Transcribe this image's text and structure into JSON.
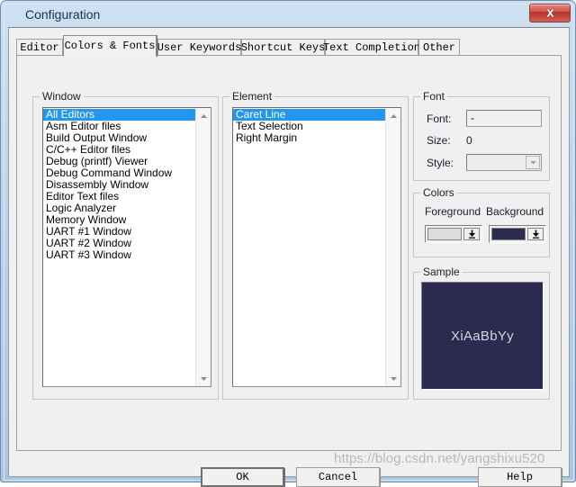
{
  "window": {
    "title": "Configuration",
    "close_label": "x"
  },
  "tabs": [
    {
      "label": "Editor",
      "selected": false
    },
    {
      "label": "Colors & Fonts",
      "selected": true
    },
    {
      "label": "User Keywords",
      "selected": false
    },
    {
      "label": "Shortcut Keys",
      "selected": false
    },
    {
      "label": "Text Completion",
      "selected": false
    },
    {
      "label": "Other",
      "selected": false
    }
  ],
  "window_group": {
    "title": "Window",
    "items": [
      {
        "label": "All Editors",
        "selected": true
      },
      {
        "label": "Asm Editor files",
        "selected": false
      },
      {
        "label": "Build Output Window",
        "selected": false
      },
      {
        "label": "C/C++ Editor files",
        "selected": false
      },
      {
        "label": "Debug (printf) Viewer",
        "selected": false
      },
      {
        "label": "Debug Command Window",
        "selected": false
      },
      {
        "label": "Disassembly Window",
        "selected": false
      },
      {
        "label": "Editor Text files",
        "selected": false
      },
      {
        "label": "Logic Analyzer",
        "selected": false
      },
      {
        "label": "Memory Window",
        "selected": false
      },
      {
        "label": "UART #1 Window",
        "selected": false
      },
      {
        "label": "UART #2 Window",
        "selected": false
      },
      {
        "label": "UART #3 Window",
        "selected": false
      }
    ]
  },
  "element_group": {
    "title": "Element",
    "items": [
      {
        "label": "Caret Line",
        "selected": true
      },
      {
        "label": "Text Selection",
        "selected": false
      },
      {
        "label": "Right Margin",
        "selected": false
      }
    ]
  },
  "font_group": {
    "title": "Font",
    "font_label": "Font:",
    "font_value": "-",
    "size_label": "Size:",
    "size_value": "0",
    "style_label": "Style:",
    "style_value": ""
  },
  "colors_group": {
    "title": "Colors",
    "foreground_label": "Foreground",
    "background_label": "Background",
    "foreground_color": "#dcdcdc",
    "background_color": "#2b2b4f"
  },
  "sample_group": {
    "title": "Sample",
    "text": "XiAaBbYy",
    "text_color": "#d5d5dd",
    "bg_color": "#2b2b4f"
  },
  "buttons": {
    "ok": "OK",
    "cancel": "Cancel",
    "help": "Help"
  },
  "watermark": "https://blog.csdn.net/yangshixu520"
}
